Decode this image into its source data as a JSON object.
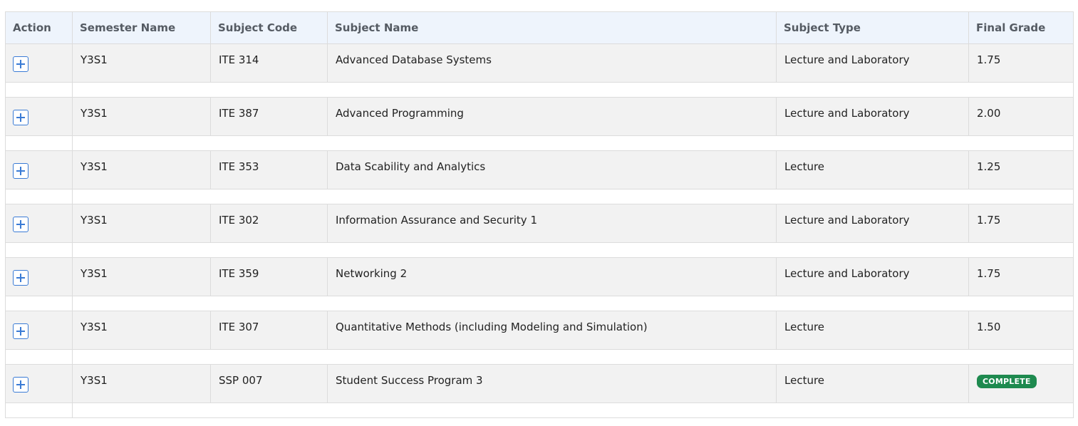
{
  "table": {
    "headers": {
      "action": "Action",
      "semester": "Semester Name",
      "code": "Subject Code",
      "name": "Subject Name",
      "type": "Subject Type",
      "grade": "Final Grade"
    },
    "rows": [
      {
        "semester": "Y3S1",
        "code": "ITE 314",
        "name": "Advanced Database Systems",
        "type": "Lecture and Laboratory",
        "grade": "1.75"
      },
      {
        "semester": "Y3S1",
        "code": "ITE 387",
        "name": "Advanced Programming",
        "type": "Lecture and Laboratory",
        "grade": "2.00"
      },
      {
        "semester": "Y3S1",
        "code": "ITE 353",
        "name": "Data Scability and Analytics",
        "type": "Lecture",
        "grade": "1.25"
      },
      {
        "semester": "Y3S1",
        "code": "ITE 302",
        "name": "Information Assurance and Security 1",
        "type": "Lecture and Laboratory",
        "grade": "1.75"
      },
      {
        "semester": "Y3S1",
        "code": "ITE 359",
        "name": "Networking 2",
        "type": "Lecture and Laboratory",
        "grade": "1.75"
      },
      {
        "semester": "Y3S1",
        "code": "ITE 307",
        "name": "Quantitative Methods (including Modeling and Simulation)",
        "type": "Lecture",
        "grade": "1.50"
      },
      {
        "semester": "Y3S1",
        "code": "SSP 007",
        "name": "Student Success Program 3",
        "type": "Lecture",
        "grade_badge": "COMPLETE"
      }
    ]
  },
  "colors": {
    "header_bg": "#eef4fc",
    "row_bg": "#f2f2f2",
    "accent": "#3a7bd5",
    "badge_bg": "#1e8a4f"
  },
  "icons": {
    "expand": "plus-square-icon"
  }
}
